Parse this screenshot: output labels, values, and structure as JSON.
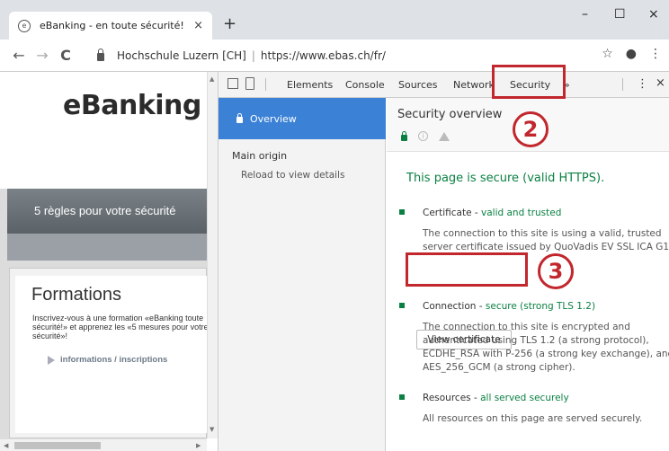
{
  "browser": {
    "tab_title": "eBanking - en toute sécurité!",
    "tab_close": "×",
    "new_tab": "+",
    "win_min": "–",
    "win_max": "☐",
    "win_close": "×",
    "back": "←",
    "forward": "→",
    "reload": "C",
    "origin_name": "Hochschule Luzern [CH]",
    "separator": "|",
    "url": "https://www.ebas.ch/fr/",
    "star": "☆",
    "account": "●",
    "menu": "⋮"
  },
  "page": {
    "logo": "eBanking",
    "banner": "5 règles pour votre sécurité",
    "panel_title": "Formations",
    "panel_text": "Inscrivez-vous à une formation «eBanking toute sécurité!» et apprenez les «5 mesures pour votre sécurité»!",
    "panel_link": "informations / inscriptions"
  },
  "devtools": {
    "tabs": [
      "Elements",
      "Console",
      "Sources",
      "Network",
      "Security"
    ],
    "more": "»",
    "menu": "⋮",
    "close": "×",
    "sidebar": {
      "overview": "Overview",
      "main_origin": "Main origin",
      "reload_hint": "Reload to view details"
    },
    "main": {
      "title": "Security overview",
      "info_glyph": "i",
      "summary": "This page is secure (valid HTTPS).",
      "certificate": {
        "label": "Certificate - ",
        "status": "valid and trusted",
        "desc": "The connection to this site is using a valid, trusted server certificate issued by QuoVadis EV SSL ICA G1.",
        "button": "View certificate"
      },
      "connection": {
        "label": "Connection - ",
        "status": "secure (strong TLS 1.2)",
        "desc": "The connection to this site is encrypted and authenticated using TLS 1.2 (a strong protocol), ECDHE_RSA with P-256 (a strong key exchange), and AES_256_GCM (a strong cipher)."
      },
      "resources": {
        "label": "Resources - ",
        "status": "all served securely",
        "desc": "All resources on this page are served securely."
      }
    }
  },
  "annotations": {
    "step2": "2",
    "step3": "3",
    "color": "#c1272d"
  },
  "colors": {
    "secure_green": "#0b8043",
    "selected_blue": "#3b82d6"
  }
}
